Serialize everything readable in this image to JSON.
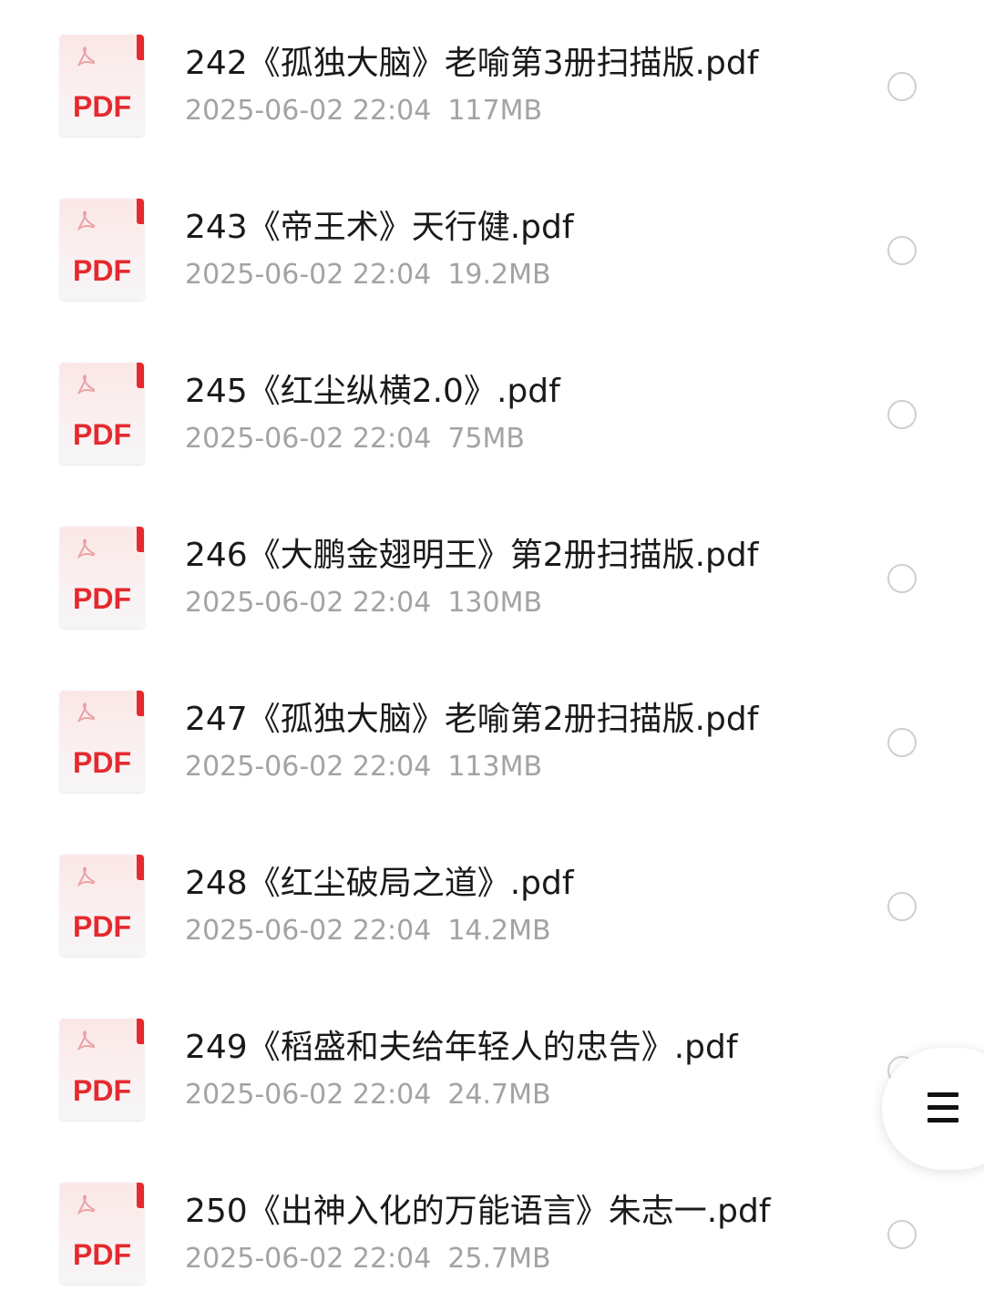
{
  "files": [
    {
      "name": "242《孤独大脑》老喻第3册扫描版.pdf",
      "date": "2025-06-02 22:04",
      "size": "117MB",
      "type_label": "PDF"
    },
    {
      "name": "243《帝王术》天行健.pdf",
      "date": "2025-06-02 22:04",
      "size": "19.2MB",
      "type_label": "PDF"
    },
    {
      "name": "245《红尘纵横2.0》.pdf",
      "date": "2025-06-02 22:04",
      "size": "75MB",
      "type_label": "PDF"
    },
    {
      "name": "246《大鹏金翅明王》第2册扫描版.pdf",
      "date": "2025-06-02 22:04",
      "size": "130MB",
      "type_label": "PDF"
    },
    {
      "name": "247《孤独大脑》老喻第2册扫描版.pdf",
      "date": "2025-06-02 22:04",
      "size": "113MB",
      "type_label": "PDF"
    },
    {
      "name": "248《红尘破局之道》.pdf",
      "date": "2025-06-02 22:04",
      "size": "14.2MB",
      "type_label": "PDF"
    },
    {
      "name": "249《稻盛和夫给年轻人的忠告》.pdf",
      "date": "2025-06-02 22:04",
      "size": "24.7MB",
      "type_label": "PDF"
    },
    {
      "name": "250《出神入化的万能语言》朱志一.pdf",
      "date": "2025-06-02 22:04",
      "size": "25.7MB",
      "type_label": "PDF"
    }
  ],
  "icons": {
    "file": "pdf-file-icon",
    "select": "radio-unselected-icon",
    "menu": "hamburger-menu-icon"
  },
  "colors": {
    "pdf_red": "#e5292e",
    "meta_gray": "#a3a3a3",
    "name_text": "#1a1a1a"
  }
}
